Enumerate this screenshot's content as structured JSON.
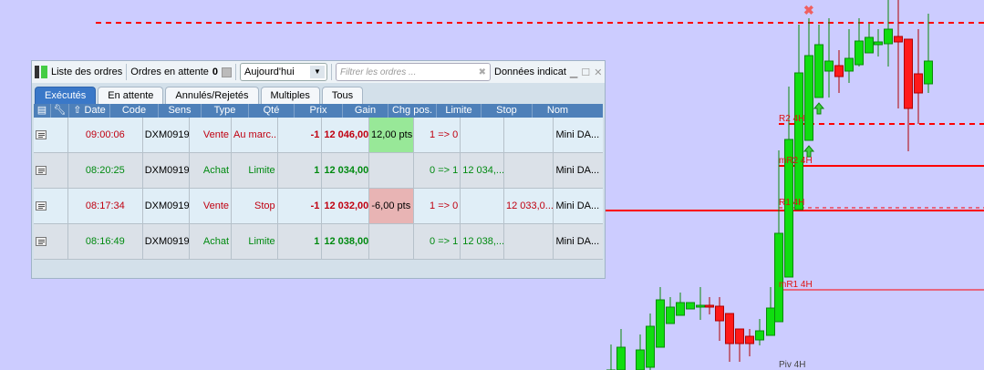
{
  "toolbar": {
    "title": "Liste des ordres",
    "pending_label": "Ordres en attente",
    "pending_count": "0",
    "period": "Aujourd'hui",
    "filter_placeholder": "Filtrer les ordres ...",
    "data_label": "Données indicat"
  },
  "tabs": [
    "Exécutés",
    "En attente",
    "Annulés/Rejetés",
    "Multiples",
    "Tous"
  ],
  "columns": [
    "Date",
    "Code",
    "Sens",
    "Type",
    "Qté",
    "Prix",
    "Gain",
    "Chg pos.",
    "Limite",
    "Stop",
    "Nom"
  ],
  "rows": [
    {
      "date": "09:00:06",
      "code": "DXM0919",
      "sens": "Vente",
      "type": "Au marc...",
      "qte": "-1",
      "prix": "12 046,00",
      "gain": "12,00 pts",
      "chg": "1 => 0",
      "limite": "",
      "stop": "",
      "nom": "Mini DA..."
    },
    {
      "date": "08:20:25",
      "code": "DXM0919",
      "sens": "Achat",
      "type": "Limite",
      "qte": "1",
      "prix": "12 034,00",
      "gain": "",
      "chg": "0 => 1",
      "limite": "12 034,...",
      "stop": "",
      "nom": "Mini DA..."
    },
    {
      "date": "08:17:34",
      "code": "DXM0919",
      "sens": "Vente",
      "type": "Stop",
      "qte": "-1",
      "prix": "12 032,00",
      "gain": "-6,00 pts",
      "chg": "1 => 0",
      "limite": "",
      "stop": "12 033,0...",
      "nom": "Mini DA..."
    },
    {
      "date": "08:16:49",
      "code": "DXM0919",
      "sens": "Achat",
      "type": "Limite",
      "qte": "1",
      "prix": "12 038,00",
      "gain": "",
      "chg": "0 => 1",
      "limite": "12 038,...",
      "stop": "",
      "nom": "Mini DA..."
    }
  ],
  "chart_labels": {
    "r2": "R2 4H",
    "mr2": "mR2 4H",
    "r1": "R1 4H",
    "mr1": "mR1 4H",
    "piv": "Piv 4H"
  },
  "colors": {
    "up": "#10dd10",
    "down": "#ff1a1a",
    "level": "#ff0000",
    "gain_pos": "#98e898",
    "gain_neg": "#e8b4b4"
  }
}
